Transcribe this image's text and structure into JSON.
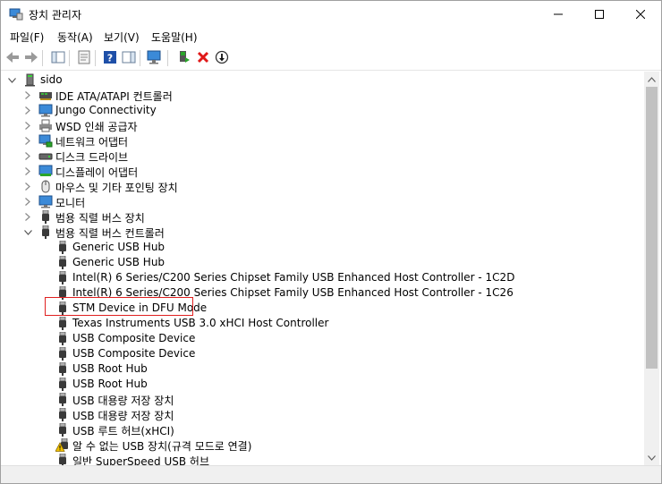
{
  "window": {
    "title": "장치 관리자"
  },
  "menu": [
    {
      "label": "파일(F)"
    },
    {
      "label": "동작(A)"
    },
    {
      "label": "보기(V)"
    },
    {
      "label": "도움말(H)"
    }
  ],
  "tree": {
    "root": "sido",
    "categories": [
      {
        "label": "IDE ATA/ATAPI 컨트롤러",
        "icon": "ide-controller-icon"
      },
      {
        "label": "Jungo Connectivity",
        "icon": "monitor-icon"
      },
      {
        "label": "WSD 인쇄 공급자",
        "icon": "printer-icon"
      },
      {
        "label": "네트워크 어댑터",
        "icon": "network-adapter-icon"
      },
      {
        "label": "디스크 드라이브",
        "icon": "disk-drive-icon"
      },
      {
        "label": "디스플레이 어댑터",
        "icon": "display-adapter-icon"
      },
      {
        "label": "마우스 및 기타 포인팅 장치",
        "icon": "mouse-icon"
      },
      {
        "label": "모니터",
        "icon": "monitor-icon"
      },
      {
        "label": "범용 직렬 버스 장치",
        "icon": "usb-icon"
      },
      {
        "label": "범용 직렬 버스 컨트롤러",
        "icon": "usb-icon"
      }
    ],
    "usb_children": [
      {
        "label": "Generic USB Hub"
      },
      {
        "label": "Generic USB Hub"
      },
      {
        "label": "Intel(R) 6 Series/C200 Series Chipset Family USB Enhanced Host Controller - 1C2D"
      },
      {
        "label": "Intel(R) 6 Series/C200 Series Chipset Family USB Enhanced Host Controller - 1C26"
      },
      {
        "label": "STM Device in DFU Mode"
      },
      {
        "label": "Texas Instruments USB 3.0 xHCI Host Controller"
      },
      {
        "label": "USB Composite Device"
      },
      {
        "label": "USB Composite Device"
      },
      {
        "label": "USB Root Hub"
      },
      {
        "label": "USB Root Hub"
      },
      {
        "label": "USB 대용량 저장 장치"
      },
      {
        "label": "USB 대용량 저장 장치"
      },
      {
        "label": "USB 루트 허브(xHCI)"
      },
      {
        "label": "알 수 없는 USB 장치(규격 모드로 연결)",
        "warning": true
      },
      {
        "label": "일반 SuperSpeed USB 허브"
      }
    ]
  },
  "colors": {
    "highlight_border": "#e02020",
    "accent_blue": "#1e73be"
  }
}
